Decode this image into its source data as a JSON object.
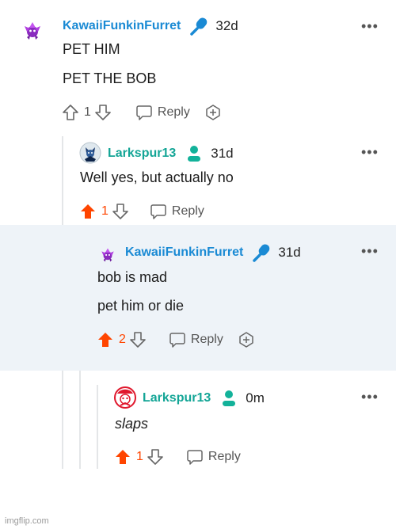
{
  "comments": [
    {
      "username": "KawaiiFunkinFurret",
      "badge": "microphone-icon",
      "age": "32d",
      "lines": [
        "PET HIM",
        "PET THE BOB"
      ],
      "votes": "1",
      "voted": false,
      "reply_label": "Reply",
      "has_award": true
    },
    {
      "username": "Larkspur13",
      "badge": "person-icon",
      "age": "31d",
      "lines": [
        "Well yes, but actually no"
      ],
      "votes": "1",
      "voted": true,
      "reply_label": "Reply",
      "has_award": false
    },
    {
      "username": "KawaiiFunkinFurret",
      "badge": "microphone-icon",
      "age": "31d",
      "lines": [
        "bob is mad",
        "pet him or die"
      ],
      "votes": "2",
      "voted": true,
      "reply_label": "Reply",
      "has_award": true
    },
    {
      "username": "Larkspur13",
      "badge": "person-icon",
      "age": "0m",
      "lines": [
        "slaps"
      ],
      "votes": "1",
      "voted": true,
      "reply_label": "Reply",
      "has_award": false
    }
  ],
  "more_label": "•••",
  "watermark": "imgflip.com",
  "colors": {
    "username": "#1a8ad4",
    "upvote_active": "#ff4500",
    "mod_badge": "#1a8ad4",
    "person_badge": "#13b29a",
    "highlight": "#eef3f8"
  }
}
